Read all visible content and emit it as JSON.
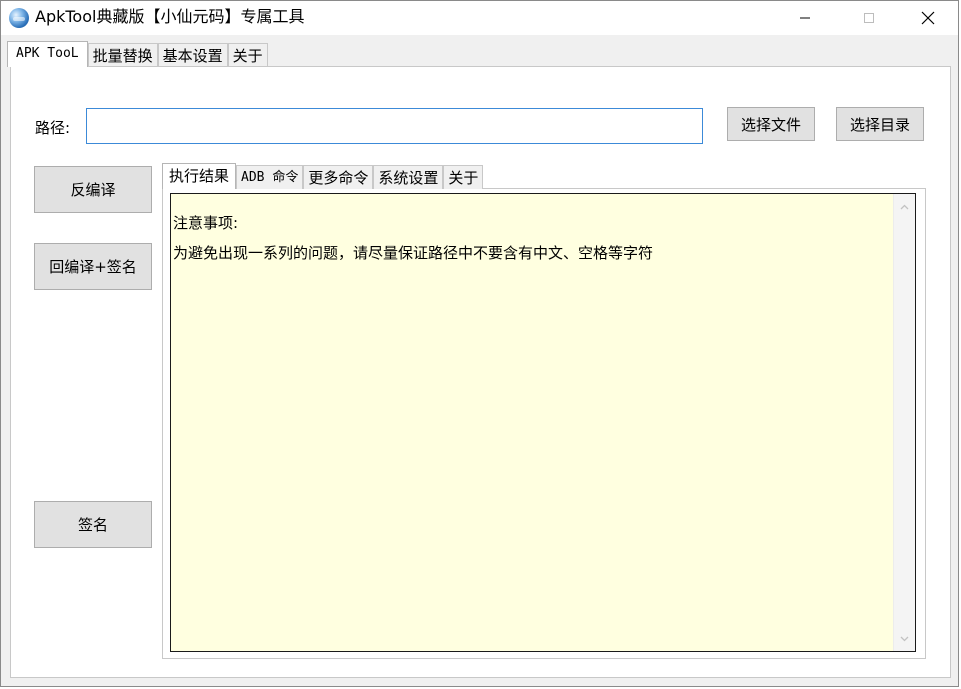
{
  "window": {
    "title": "ApkTool典藏版【小仙元码】专属工具"
  },
  "top_tabs": [
    {
      "label": "APK TooL",
      "active": true
    },
    {
      "label": "批量替换",
      "active": false
    },
    {
      "label": "基本设置",
      "active": false
    },
    {
      "label": "关于",
      "active": false
    }
  ],
  "path": {
    "label": "路径:",
    "value": "",
    "placeholder": ""
  },
  "buttons": {
    "pick_file": "选择文件",
    "pick_dir": "选择目录",
    "decompile": "反编译",
    "recompile_sign": "回编译+签名",
    "sign": "签名"
  },
  "inner_tabs": [
    {
      "label": "执行结果",
      "active": true
    },
    {
      "label": "ADB 命令",
      "active": false
    },
    {
      "label": "更多命令",
      "active": false
    },
    {
      "label": "系统设置",
      "active": false
    },
    {
      "label": "关于",
      "active": false
    }
  ],
  "output": {
    "lines": "注意事项:\n为避免出现一系列的问题，请尽量保证路径中不要含有中文、空格等字符"
  },
  "icons": {
    "app": "globe-icon",
    "minimize": "minimize-icon",
    "maximize": "maximize-icon",
    "close": "close-icon",
    "scroll_up": "chevron-up-icon",
    "scroll_down": "chevron-down-icon"
  },
  "colors": {
    "output_background": "#ffffe0",
    "input_border": "#3c8ad8",
    "button_face": "#e1e1e1"
  }
}
